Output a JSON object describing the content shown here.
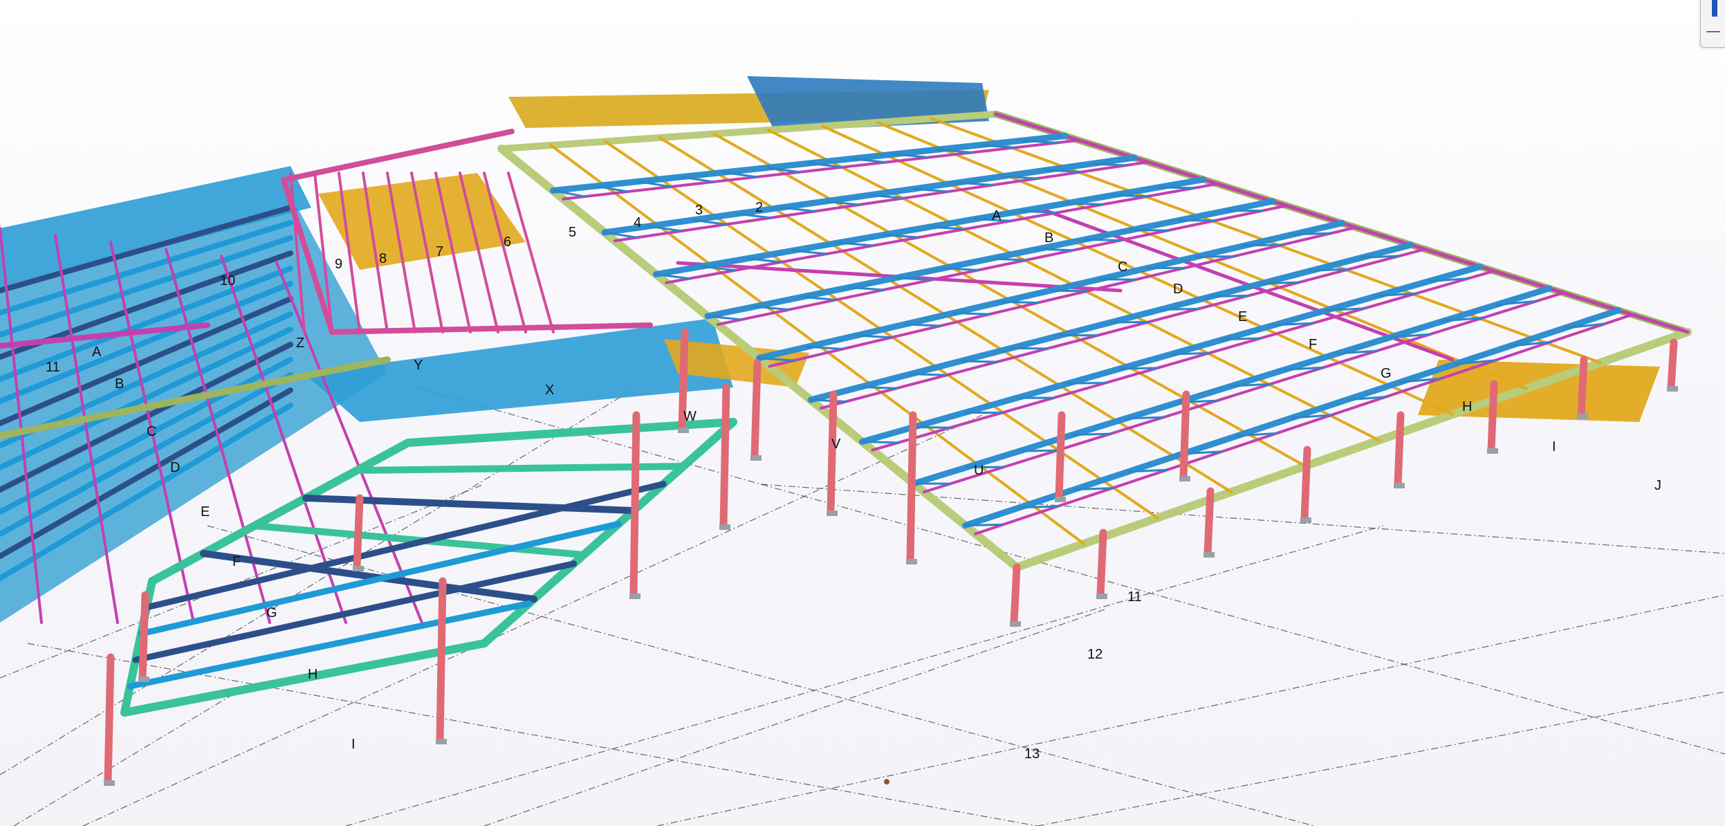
{
  "colors": {
    "background": "#f5f5fa",
    "column": "#e06a74",
    "perimeter_beam": "#9cb55e",
    "roof_truss": "#2f8fd0",
    "bracing": "#c43fb0",
    "secondary_beam": "#e2a91d",
    "framing_green": "#39c39a",
    "framing_navy": "#2c4f8a",
    "deck": "#1e9ad6",
    "accent": "#1f57b8"
  },
  "grid_labels": {
    "right_block_numbers": [
      "2",
      "3",
      "4",
      "5",
      "6",
      "7",
      "8",
      "9",
      "10",
      "11",
      "12",
      "13"
    ],
    "right_block_letters": [
      "A",
      "B",
      "C",
      "D",
      "E",
      "F",
      "G",
      "H",
      "I",
      "J"
    ],
    "perimeter_letters": [
      "U",
      "V",
      "W",
      "X",
      "Y",
      "Z"
    ],
    "left_block_letters": [
      "A",
      "B",
      "C",
      "D",
      "E",
      "F",
      "G",
      "H",
      "I"
    ],
    "left_block_numbers": [
      "11"
    ]
  },
  "window_control": {
    "indicator": "view-indicator",
    "minimize_symbol": "—"
  }
}
